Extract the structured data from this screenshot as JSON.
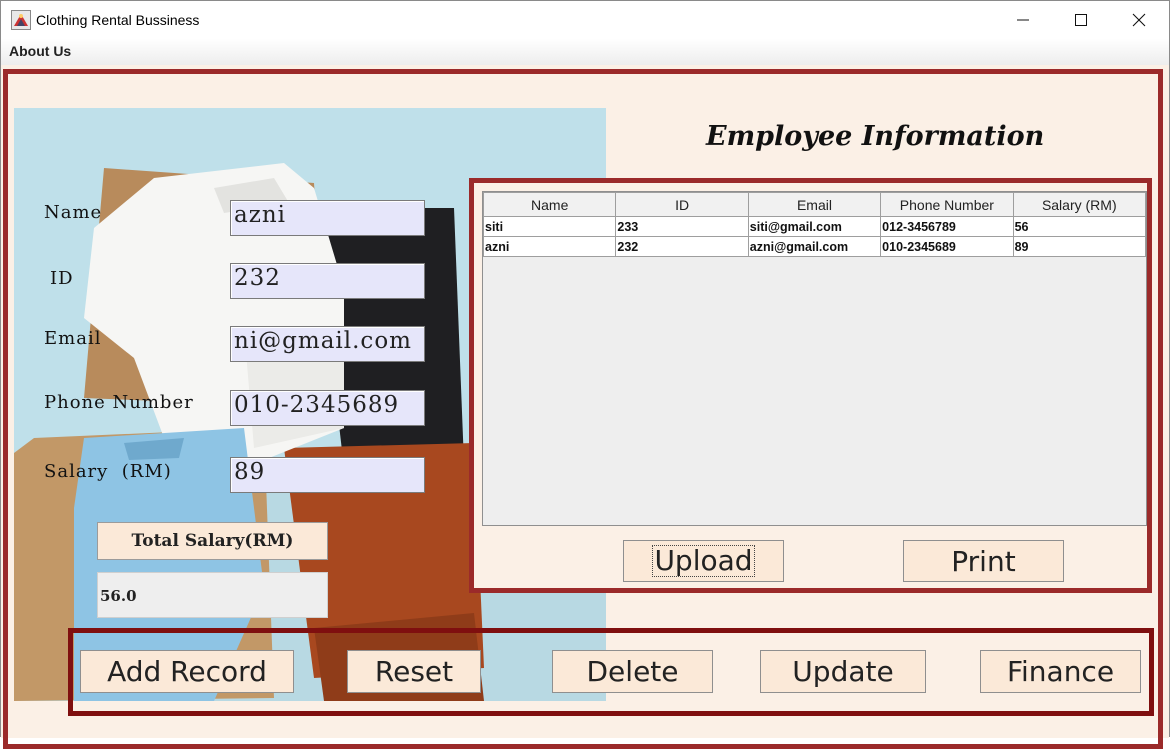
{
  "window": {
    "title": "Clothing Rental Bussiness",
    "controls": {
      "minimize": "minimize",
      "maximize": "maximize",
      "close": "close"
    }
  },
  "menu": {
    "items": [
      "About Us"
    ]
  },
  "form": {
    "labels": {
      "name": "Name",
      "id": "ID",
      "email": "Email",
      "phone": "Phone Number",
      "salary": "Salary  (RM)"
    },
    "values": {
      "name": "azni",
      "id": "232",
      "email": "ni@gmail.com",
      "phone": "010-2345689",
      "salary": "89"
    },
    "total_button": "Total Salary(RM)",
    "total_value": "56.0"
  },
  "employee": {
    "title": "Employee Information",
    "table": {
      "columns": [
        "Name",
        "ID",
        "Email",
        "Phone Number",
        "Salary (RM)"
      ],
      "rows": [
        [
          "siti",
          "233",
          "siti@gmail.com",
          "012-3456789",
          "56"
        ],
        [
          "azni",
          "232",
          "azni@gmail.com",
          "010-2345689",
          "89"
        ]
      ]
    },
    "upload_label": "Upload",
    "print_label": "Print"
  },
  "actions": {
    "add": "Add Record",
    "reset": "Reset",
    "delete": "Delete",
    "update": "Update",
    "finance": "Finance"
  },
  "colors": {
    "frame": "#9b2a2a",
    "background": "#fbf0e6",
    "button": "#fbe9d8",
    "field": "#e6e6fa"
  }
}
